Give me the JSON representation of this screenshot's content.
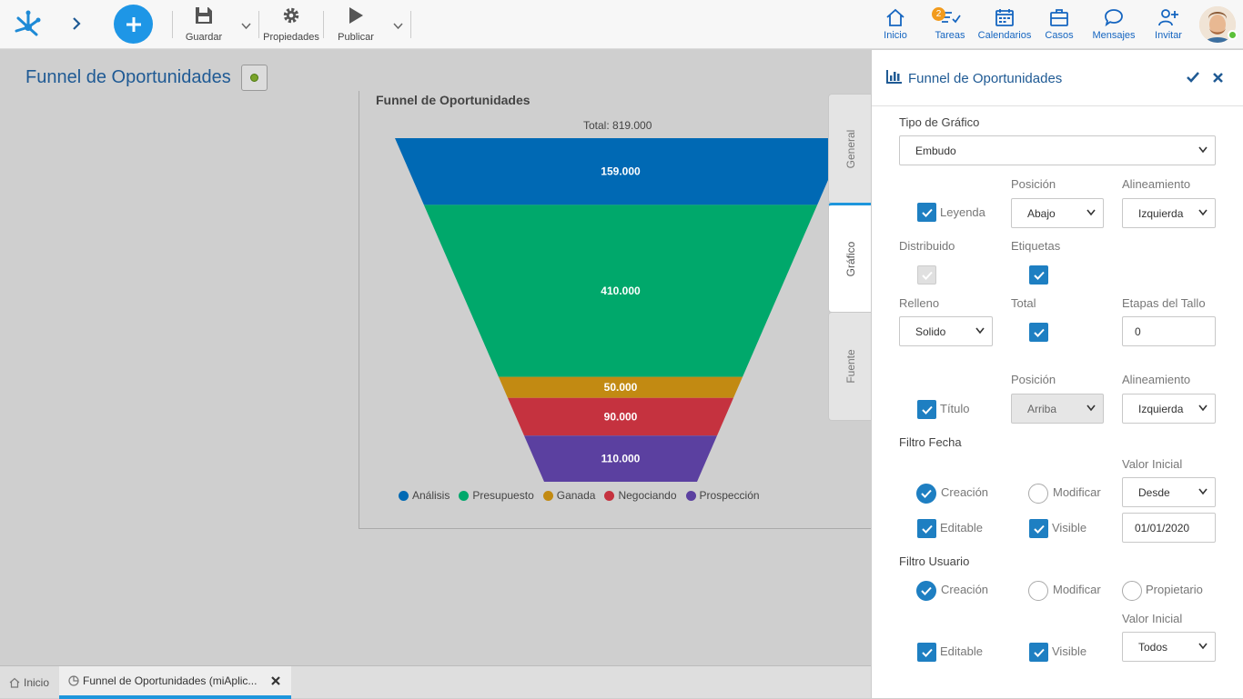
{
  "topbar": {
    "save_label": "Guardar",
    "properties_label": "Propiedades",
    "publish_label": "Publicar",
    "nav": [
      {
        "label": "Inicio",
        "icon": "home-icon"
      },
      {
        "label": "Tareas",
        "icon": "tasks-icon",
        "badge": "2"
      },
      {
        "label": "Calendarios",
        "icon": "calendar-icon"
      },
      {
        "label": "Casos",
        "icon": "briefcase-icon"
      },
      {
        "label": "Mensajes",
        "icon": "chat-icon"
      },
      {
        "label": "Invitar",
        "icon": "invite-user-icon"
      }
    ]
  },
  "page": {
    "title": "Funnel de Oportunidades"
  },
  "chart_data": {
    "type": "funnel",
    "title": "Funnel de Oportunidades",
    "total_label": "Total: 819.000",
    "categories": [
      "Análisis",
      "Presupuesto",
      "Ganada",
      "Negociando",
      "Prospección"
    ],
    "values": [
      159000,
      410000,
      50000,
      90000,
      110000
    ],
    "value_labels": [
      "159.000",
      "410.000",
      "50.000",
      "90.000",
      "110.000"
    ],
    "colors": [
      "#0069b4",
      "#00a86b",
      "#c28a12",
      "#c5323f",
      "#5b40a0"
    ],
    "legend_position": "bottom"
  },
  "side_tabs": [
    "General",
    "Gráfico",
    "Fuente"
  ],
  "props": {
    "title": "Funnel de Oportunidades",
    "chart_type_label": "Tipo de Gráfico",
    "chart_type_value": "Embudo",
    "position_label": "Posición",
    "alignment_label": "Alineamiento",
    "legend_label": "Leyenda",
    "legend_position": "Abajo",
    "legend_alignment": "Izquierda",
    "distributed_label": "Distribuido",
    "labels_label": "Etiquetas",
    "fill_label": "Relleno",
    "total_label": "Total",
    "stem_label": "Etapas del Tallo",
    "fill_value": "Solido",
    "stem_value": "0",
    "title_label": "Título",
    "title_position": "Arriba",
    "title_alignment": "Izquierda",
    "date_filter_label": "Filtro Fecha",
    "initial_value_label": "Valor Inicial",
    "creation_label": "Creación",
    "modify_label": "Modificar",
    "date_initial_select": "Desde",
    "editable_label": "Editable",
    "visible_label": "Visible",
    "date_value": "01/01/2020",
    "user_filter_label": "Filtro Usuario",
    "owner_label": "Propietario",
    "user_initial_value": "Todos"
  },
  "bottom_tabs": {
    "home": "Inicio",
    "doc": "Funnel de Oportunidades (miAplic..."
  }
}
